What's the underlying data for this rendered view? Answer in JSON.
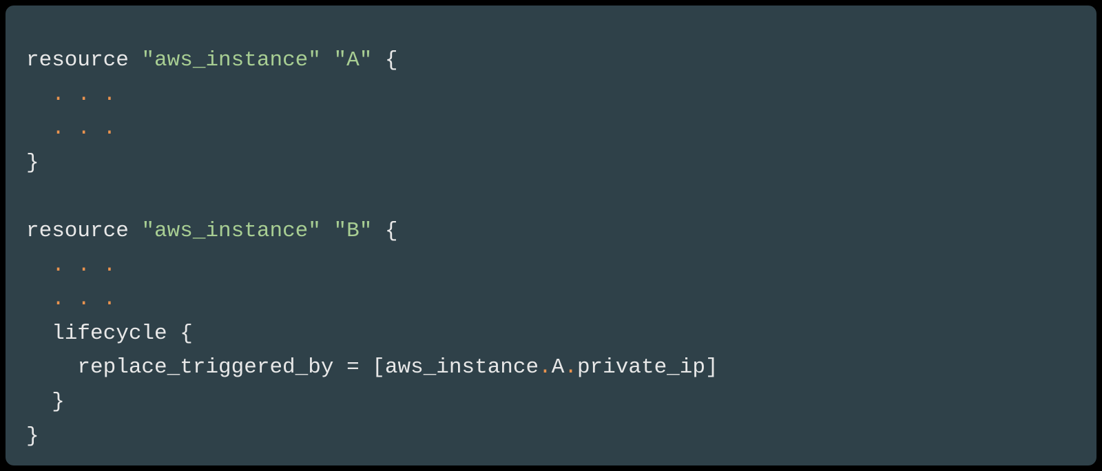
{
  "code": {
    "colors": {
      "background": "#2f4149",
      "plain": "#e8e8e8",
      "string": "#a8ce93",
      "orange": "#e9934f"
    },
    "lines": [
      [
        {
          "text": "resource ",
          "cls": "plain"
        },
        {
          "text": "\"aws_instance\"",
          "cls": "string"
        },
        {
          "text": " ",
          "cls": "plain"
        },
        {
          "text": "\"A\"",
          "cls": "string"
        },
        {
          "text": " {",
          "cls": "plain"
        }
      ],
      [
        {
          "text": "  ",
          "cls": "plain"
        },
        {
          "text": ". . .",
          "cls": "orange"
        }
      ],
      [
        {
          "text": "  ",
          "cls": "plain"
        },
        {
          "text": ". . .",
          "cls": "orange"
        }
      ],
      [
        {
          "text": "}",
          "cls": "plain"
        }
      ],
      [
        {
          "text": "",
          "cls": "plain"
        }
      ],
      [
        {
          "text": "resource ",
          "cls": "plain"
        },
        {
          "text": "\"aws_instance\"",
          "cls": "string"
        },
        {
          "text": " ",
          "cls": "plain"
        },
        {
          "text": "\"B\"",
          "cls": "string"
        },
        {
          "text": " {",
          "cls": "plain"
        }
      ],
      [
        {
          "text": "  ",
          "cls": "plain"
        },
        {
          "text": ". . .",
          "cls": "orange"
        }
      ],
      [
        {
          "text": "  ",
          "cls": "plain"
        },
        {
          "text": ". . .",
          "cls": "orange"
        }
      ],
      [
        {
          "text": "  lifecycle {",
          "cls": "plain"
        }
      ],
      [
        {
          "text": "    replace_triggered_by = [aws_instance",
          "cls": "plain"
        },
        {
          "text": ".",
          "cls": "orange"
        },
        {
          "text": "A",
          "cls": "plain"
        },
        {
          "text": ".",
          "cls": "orange"
        },
        {
          "text": "private_ip]",
          "cls": "plain"
        }
      ],
      [
        {
          "text": "  }",
          "cls": "plain"
        }
      ],
      [
        {
          "text": "}",
          "cls": "plain"
        }
      ]
    ]
  }
}
